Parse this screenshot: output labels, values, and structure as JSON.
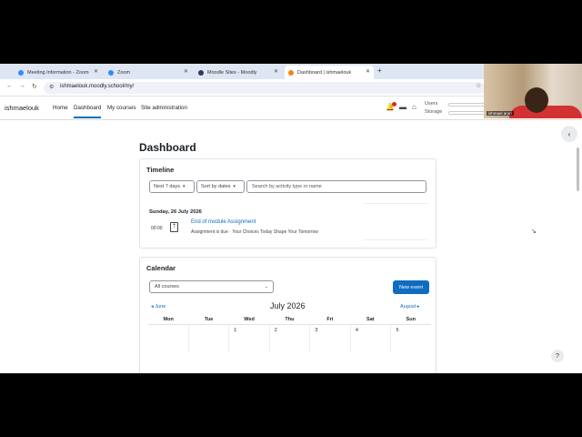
{
  "tabs": [
    {
      "label": "Meeting Information - Zoom",
      "icon": "zoom-icon"
    },
    {
      "label": "Zoom",
      "icon": "zoom-icon"
    },
    {
      "label": "Moodle Sites - Moodly",
      "icon": "moodle-icon"
    },
    {
      "label": "Dashboard | ishmaelouk",
      "icon": "moodle-icon"
    }
  ],
  "address": {
    "url": "ishmaelouk.moodly.school/my/"
  },
  "nav": {
    "brand": "ishmaelouk",
    "links": [
      "Home",
      "Dashboard",
      "My courses",
      "Site administration"
    ],
    "users_label": "Users",
    "storage_label": "Storage"
  },
  "webcam": {
    "name": "ishmael arori"
  },
  "page": {
    "title": "Dashboard"
  },
  "timeline": {
    "heading": "Timeline",
    "filter_days": "Next 7 days",
    "sort": "Sort by dates",
    "search_placeholder": "Search by activity type or name",
    "date": "Sunday, 26 July 2026",
    "event_time": "00:00",
    "event_title": "End of module Assignment",
    "event_desc": "Assignment is due · Your Choices Today Shape Your Tomorrow"
  },
  "calendar": {
    "heading": "Calendar",
    "course_select": "All courses",
    "new_event": "New event",
    "month": "July 2026",
    "prev": "June",
    "next": "August",
    "days": [
      "Mon",
      "Tue",
      "Wed",
      "Thu",
      "Fri",
      "Sat",
      "Sun"
    ],
    "first_row": [
      "",
      "",
      "1",
      "2",
      "3",
      "4",
      "5"
    ]
  },
  "colors": {
    "accent": "#0f6cbf",
    "tabstrip": "#dfe6f3"
  }
}
